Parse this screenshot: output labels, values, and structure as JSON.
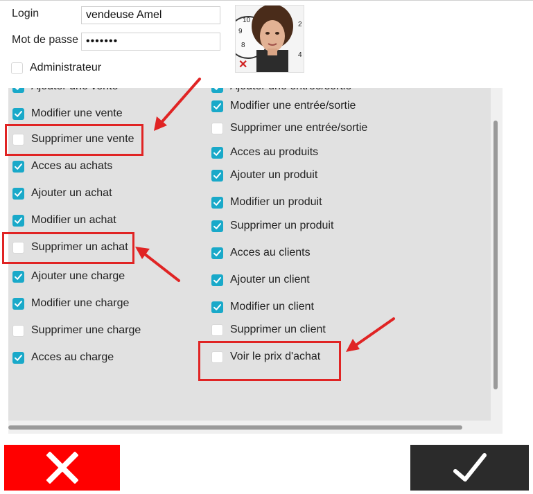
{
  "form": {
    "login_label": "Login",
    "login_value": "vendeuse Amel",
    "password_label": "Mot de passe",
    "password_value": "1234567",
    "admin_label": "Administrateur",
    "admin_checked": false
  },
  "permissions_left": [
    {
      "label": "Ajouter une vente",
      "checked": true
    },
    {
      "label": "Modifier une vente",
      "checked": true
    },
    {
      "label": "Supprimer une vente",
      "checked": false
    },
    {
      "label": "Acces au achats",
      "checked": true
    },
    {
      "label": "Ajouter un achat",
      "checked": true
    },
    {
      "label": "Modifier un achat",
      "checked": true
    },
    {
      "label": "Supprimer un achat",
      "checked": false
    },
    {
      "label": "Ajouter une charge",
      "checked": true
    },
    {
      "label": "Modifier une charge",
      "checked": true
    },
    {
      "label": "Supprimer une charge",
      "checked": false
    },
    {
      "label": "Acces au charge",
      "checked": true
    }
  ],
  "permissions_right": [
    {
      "label": "Ajouter une entrée/sortie",
      "checked": true
    },
    {
      "label": "Modifier une entrée/sortie",
      "checked": true
    },
    {
      "label": "Supprimer une entrée/sortie",
      "checked": false
    },
    {
      "label": "Acces au produits",
      "checked": true
    },
    {
      "label": "Ajouter un produit",
      "checked": true
    },
    {
      "label": "Modifier un produit",
      "checked": true
    },
    {
      "label": "Supprimer un produit",
      "checked": true
    },
    {
      "label": "Acces au clients",
      "checked": true
    },
    {
      "label": "Ajouter un client",
      "checked": true
    },
    {
      "label": "Modifier un client",
      "checked": true
    },
    {
      "label": "Supprimer un client",
      "checked": false
    },
    {
      "label": "Voir le prix d'achat",
      "checked": false
    }
  ],
  "colors": {
    "checkbox_checked": "#19a9c9",
    "panel_bg": "#e1e1e1",
    "annotation_red": "#e02424",
    "cancel_bg": "#ff0000",
    "confirm_bg": "#2b2b2b"
  },
  "icons": {
    "photo_delete": "close-icon",
    "cancel": "close-icon",
    "confirm": "checkmark-icon"
  }
}
